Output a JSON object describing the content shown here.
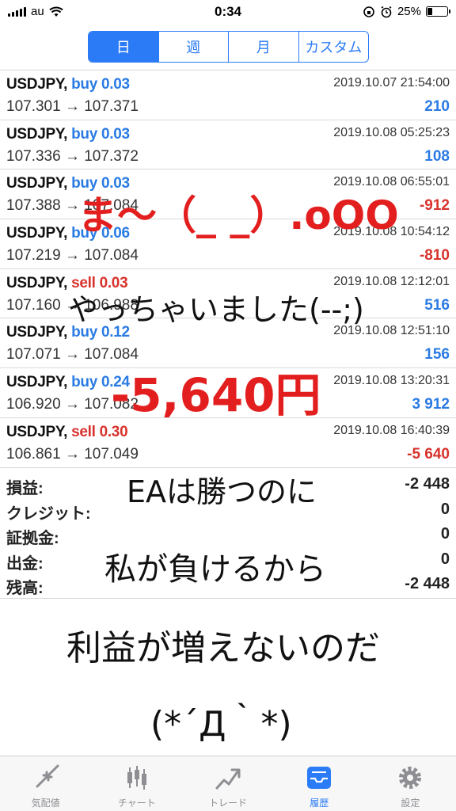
{
  "status_bar": {
    "carrier": "au",
    "time": "0:34",
    "battery": "25%",
    "battery_level": 0.25
  },
  "segments": [
    {
      "label": "日",
      "active": true
    },
    {
      "label": "週",
      "active": false
    },
    {
      "label": "月",
      "active": false
    },
    {
      "label": "カスタム",
      "active": false
    }
  ],
  "deals": [
    {
      "symbol": "USDJPY,",
      "type": "buy",
      "volume": "buy 0.03",
      "time": "2019.10.07 21:54:00",
      "prices": "107.301 → 107.371",
      "profit": "210"
    },
    {
      "symbol": "USDJPY,",
      "type": "buy",
      "volume": "buy 0.03",
      "time": "2019.10.08 05:25:23",
      "prices": "107.336 → 107.372",
      "profit": "108"
    },
    {
      "symbol": "USDJPY,",
      "type": "buy",
      "volume": "buy 0.03",
      "time": "2019.10.08 06:55:01",
      "prices": "107.388 → 107.084",
      "profit": "-912"
    },
    {
      "symbol": "USDJPY,",
      "type": "buy",
      "volume": "buy 0.06",
      "time": "2019.10.08 10:54:12",
      "prices": "107.219 → 107.084",
      "profit": "-810"
    },
    {
      "symbol": "USDJPY,",
      "type": "sell",
      "volume": "sell 0.03",
      "time": "2019.10.08 12:12:01",
      "prices": "107.160 → 106.988",
      "profit": "516"
    },
    {
      "symbol": "USDJPY,",
      "type": "buy",
      "volume": "buy 0.12",
      "time": "2019.10.08 12:51:10",
      "prices": "107.071 → 107.084",
      "profit": "156"
    },
    {
      "symbol": "USDJPY,",
      "type": "buy",
      "volume": "buy 0.24",
      "time": "2019.10.08 13:20:31",
      "prices": "106.920 → 107.082",
      "profit": "3 912"
    },
    {
      "symbol": "USDJPY,",
      "type": "sell",
      "volume": "sell 0.30",
      "time": "2019.10.08 16:40:39",
      "prices": "106.861 → 107.049",
      "profit": "-5 640"
    }
  ],
  "summary": [
    {
      "label": "損益:",
      "value": "-2 448"
    },
    {
      "label": "クレジット:",
      "value": "0"
    },
    {
      "label": "証拠金:",
      "value": "0"
    },
    {
      "label": "出金:",
      "value": "0"
    },
    {
      "label": "残高:",
      "value": "-2 448"
    }
  ],
  "handwriting": {
    "line1": "ま〜（_ _）.oOO",
    "line2": "やっちゃいました(--;)",
    "line3": "-5,640円",
    "line4": "EAは勝つのに",
    "line5": "私が負けるから",
    "line6": "利益が増えないのだ",
    "line7": "(*´Д｀*)"
  },
  "tabs": [
    {
      "label": "気配値",
      "icon": "quotes-arrows-icon",
      "active": false
    },
    {
      "label": "チャート",
      "icon": "candlestick-chart-icon",
      "active": false
    },
    {
      "label": "トレード",
      "icon": "trade-trend-icon",
      "active": false
    },
    {
      "label": "履歴",
      "icon": "history-inbox-icon",
      "active": true
    },
    {
      "label": "設定",
      "icon": "gear-icon",
      "active": false
    }
  ],
  "colors": {
    "accent": "#2b7bf6",
    "buy": "#2a7be4",
    "sell": "#d8322c",
    "handwriting_red": "#e31e1e"
  }
}
